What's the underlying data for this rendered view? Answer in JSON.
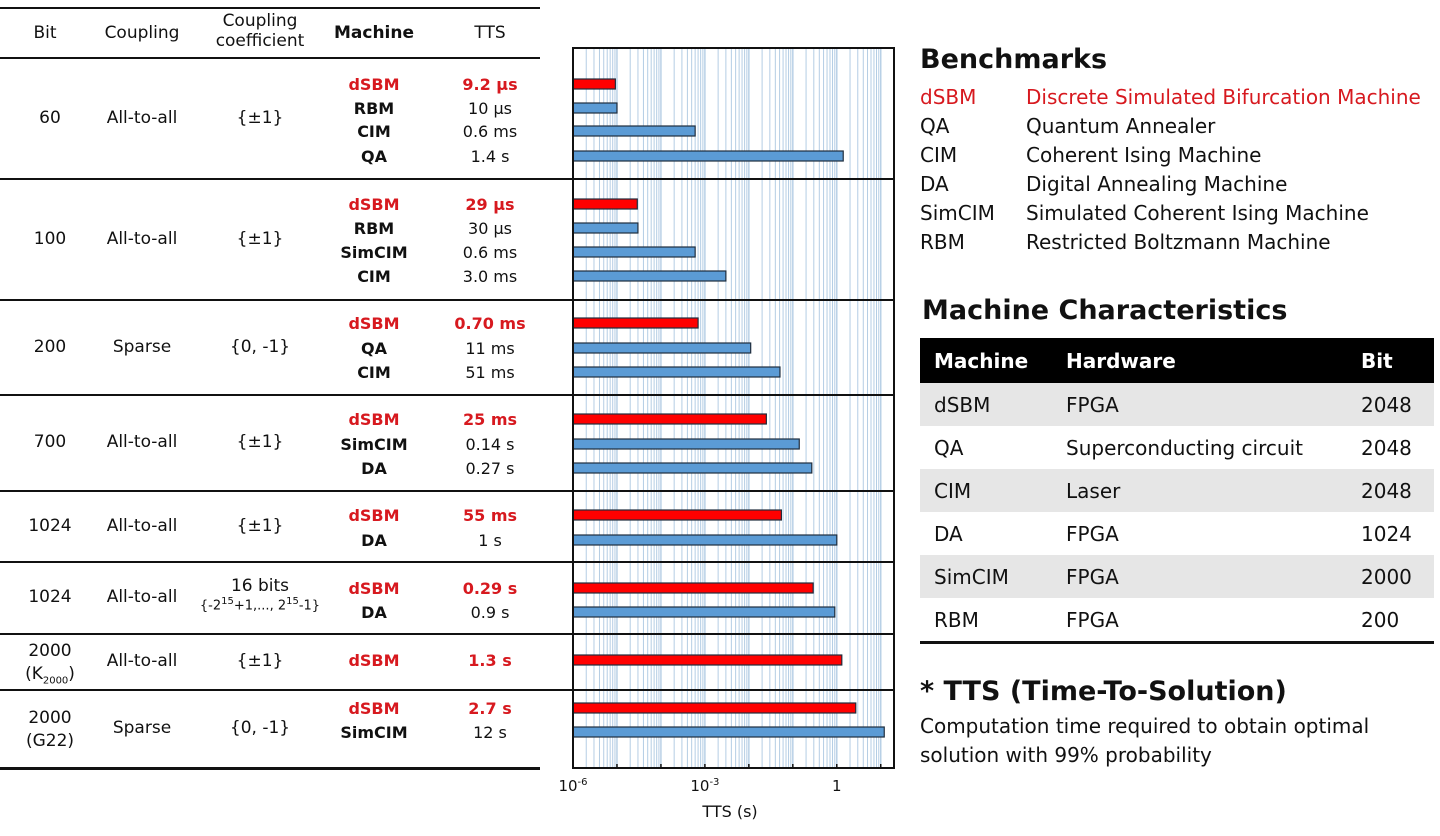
{
  "table": {
    "headers": {
      "bit": "Bit",
      "coupling": "Coupling",
      "coupling_coefficient_line1": "Coupling",
      "coupling_coefficient_line2": "coefficient",
      "machine": "Machine",
      "tts": "TTS"
    },
    "groups": [
      {
        "bit": "60",
        "bit_sub": "",
        "coupling": "All-to-all",
        "coefficient": "{±1}",
        "coefficient_sub": "",
        "entries": [
          {
            "machine": "dSBM",
            "tts": "9.2 µs",
            "highlight": true
          },
          {
            "machine": "RBM",
            "tts": "10 µs",
            "highlight": false
          },
          {
            "machine": "CIM",
            "tts": "0.6 ms",
            "highlight": false
          },
          {
            "machine": "QA",
            "tts": "1.4 s",
            "highlight": false
          }
        ]
      },
      {
        "bit": "100",
        "bit_sub": "",
        "coupling": "All-to-all",
        "coefficient": "{±1}",
        "coefficient_sub": "",
        "entries": [
          {
            "machine": "dSBM",
            "tts": "29 µs",
            "highlight": true
          },
          {
            "machine": "RBM",
            "tts": "30 µs",
            "highlight": false
          },
          {
            "machine": "SimCIM",
            "tts": "0.6 ms",
            "highlight": false
          },
          {
            "machine": "CIM",
            "tts": "3.0 ms",
            "highlight": false
          }
        ]
      },
      {
        "bit": "200",
        "bit_sub": "",
        "coupling": "Sparse",
        "coefficient": "{0, -1}",
        "coefficient_sub": "",
        "entries": [
          {
            "machine": "dSBM",
            "tts": "0.70 ms",
            "highlight": true
          },
          {
            "machine": "QA",
            "tts": "11 ms",
            "highlight": false
          },
          {
            "machine": "CIM",
            "tts": "51 ms",
            "highlight": false
          }
        ]
      },
      {
        "bit": "700",
        "bit_sub": "",
        "coupling": "All-to-all",
        "coefficient": "{±1}",
        "coefficient_sub": "",
        "entries": [
          {
            "machine": "dSBM",
            "tts": "25 ms",
            "highlight": true
          },
          {
            "machine": "SimCIM",
            "tts": "0.14 s",
            "highlight": false
          },
          {
            "machine": "DA",
            "tts": "0.27 s",
            "highlight": false
          }
        ]
      },
      {
        "bit": "1024",
        "bit_sub": "",
        "coupling": "All-to-all",
        "coefficient": "{±1}",
        "coefficient_sub": "",
        "entries": [
          {
            "machine": "dSBM",
            "tts": "55 ms",
            "highlight": true
          },
          {
            "machine": "DA",
            "tts": "1 s",
            "highlight": false
          }
        ]
      },
      {
        "bit": "1024",
        "bit_sub": "",
        "coupling": "All-to-all",
        "coefficient": "16 bits",
        "coefficient_sub": "{-2^15+1,..., 2^15-1}",
        "entries": [
          {
            "machine": "dSBM",
            "tts": "0.29 s",
            "highlight": true
          },
          {
            "machine": "DA",
            "tts": "0.9 s",
            "highlight": false
          }
        ]
      },
      {
        "bit": "2000",
        "bit_sub": "(K2000)",
        "coupling": "All-to-all",
        "coefficient": "{±1}",
        "coefficient_sub": "",
        "entries": [
          {
            "machine": "dSBM",
            "tts": "1.3 s",
            "highlight": true
          }
        ]
      },
      {
        "bit": "2000",
        "bit_sub": "(G22)",
        "coupling": "Sparse",
        "coefficient": "{0, -1}",
        "coefficient_sub": "",
        "entries": [
          {
            "machine": "dSBM",
            "tts": "2.7 s",
            "highlight": true
          },
          {
            "machine": "SimCIM",
            "tts": "12 s",
            "highlight": false
          }
        ]
      }
    ]
  },
  "chart_data": {
    "type": "bar",
    "orientation": "horizontal",
    "xscale": "log",
    "xlabel": "TTS (s)",
    "xlim": [
      1e-06,
      20
    ],
    "xticks": [
      {
        "value": 1e-06,
        "label": "10^-6"
      },
      {
        "value": 0.001,
        "label": "10^-3"
      },
      {
        "value": 1,
        "label": "1"
      }
    ],
    "grid": true,
    "colors": {
      "dSBM": "#ff0000",
      "other": "#5b9bd5",
      "edge": "#1f2d3d",
      "grid": "#b4cde4"
    },
    "groups": [
      {
        "bit": "60",
        "bars": [
          {
            "machine": "dSBM",
            "value": 9.2e-06
          },
          {
            "machine": "RBM",
            "value": 1e-05
          },
          {
            "machine": "CIM",
            "value": 0.0006
          },
          {
            "machine": "QA",
            "value": 1.4
          }
        ]
      },
      {
        "bit": "100",
        "bars": [
          {
            "machine": "dSBM",
            "value": 2.9e-05
          },
          {
            "machine": "RBM",
            "value": 3e-05
          },
          {
            "machine": "SimCIM",
            "value": 0.0006
          },
          {
            "machine": "CIM",
            "value": 0.003
          }
        ]
      },
      {
        "bit": "200",
        "bars": [
          {
            "machine": "dSBM",
            "value": 0.0007
          },
          {
            "machine": "QA",
            "value": 0.011
          },
          {
            "machine": "CIM",
            "value": 0.051
          }
        ]
      },
      {
        "bit": "700",
        "bars": [
          {
            "machine": "dSBM",
            "value": 0.025
          },
          {
            "machine": "SimCIM",
            "value": 0.14
          },
          {
            "machine": "DA",
            "value": 0.27
          }
        ]
      },
      {
        "bit": "1024",
        "bars": [
          {
            "machine": "dSBM",
            "value": 0.055
          },
          {
            "machine": "DA",
            "value": 1
          }
        ]
      },
      {
        "bit": "1024 (16 bits)",
        "bars": [
          {
            "machine": "dSBM",
            "value": 0.29
          },
          {
            "machine": "DA",
            "value": 0.9
          }
        ]
      },
      {
        "bit": "2000 (K2000)",
        "bars": [
          {
            "machine": "dSBM",
            "value": 1.3
          }
        ]
      },
      {
        "bit": "2000 (G22)",
        "bars": [
          {
            "machine": "dSBM",
            "value": 2.7
          },
          {
            "machine": "SimCIM",
            "value": 12
          }
        ]
      }
    ]
  },
  "benchmarks": {
    "title": "Benchmarks",
    "items": [
      {
        "abbr": "dSBM",
        "name": "Discrete Simulated Bifurcation Machine",
        "highlight": true
      },
      {
        "abbr": "QA",
        "name": "Quantum Annealer",
        "highlight": false
      },
      {
        "abbr": "CIM",
        "name": "Coherent Ising Machine",
        "highlight": false
      },
      {
        "abbr": "DA",
        "name": "Digital Annealing Machine",
        "highlight": false
      },
      {
        "abbr": "SimCIM",
        "name": "Simulated Coherent Ising Machine",
        "highlight": false
      },
      {
        "abbr": "RBM",
        "name": "Restricted Boltzmann Machine",
        "highlight": false
      }
    ]
  },
  "machine_characteristics": {
    "title": "Machine Characteristics",
    "headers": [
      "Machine",
      "Hardware",
      "Bit"
    ],
    "rows": [
      [
        "dSBM",
        "FPGA",
        "2048"
      ],
      [
        "QA",
        "Superconducting circuit",
        "2048"
      ],
      [
        "CIM",
        "Laser",
        "2048"
      ],
      [
        "DA",
        "FPGA",
        "1024"
      ],
      [
        "SimCIM",
        "FPGA",
        "2000"
      ],
      [
        "RBM",
        "FPGA",
        "200"
      ]
    ]
  },
  "tts_note": {
    "title": "* TTS (Time-To-Solution)",
    "body": "Computation time required to obtain optimal solution with 99% probability"
  }
}
